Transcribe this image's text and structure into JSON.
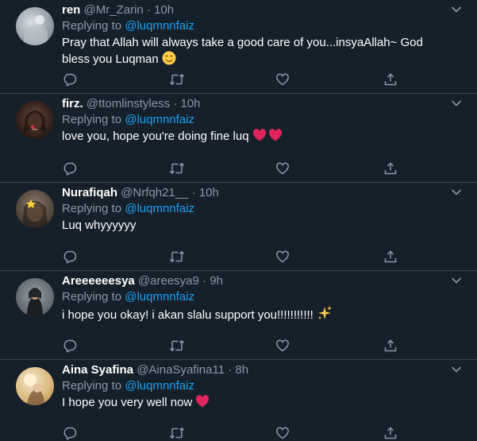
{
  "replying_label": "Replying to",
  "replying_mention": "@luqmnnfaiz",
  "tweets": [
    {
      "name": "ren",
      "handle": "@Mr_Zarin",
      "separator": "·",
      "time": "10h",
      "text": "Pray that Allah will always take a good care of you...insyaAllah~ God bless you Luqman",
      "emoji": "☺"
    },
    {
      "name": "firz.",
      "handle": "@ttomlinstyless",
      "separator": "·",
      "time": "10h",
      "text": "love you, hope you're doing fine luq",
      "emoji": "❤️❤️"
    },
    {
      "name": "Nurafiqah",
      "handle": "@Nrfqh21__",
      "separator": "·",
      "time": "10h",
      "text": "Luq whyyyyyy",
      "emoji": ""
    },
    {
      "name": "Areeeeeesya",
      "handle": "@areesya9",
      "separator": "·",
      "time": "9h",
      "text": "i hope you okay!  i akan slalu support you!!!!!!!!!!!",
      "emoji": "✨"
    },
    {
      "name": "Aina Syafina",
      "handle": "@AinaSyafina11",
      "separator": "·",
      "time": "8h",
      "text": "I hope you very well now",
      "emoji": "❤️"
    }
  ],
  "colors": {
    "background": "#15202b",
    "secondary_text": "#8899a6",
    "link": "#1da1f2",
    "divider": "#38444d",
    "heart_emoji": "#e0245e"
  },
  "icons": [
    "reply-icon",
    "retweet-icon",
    "like-icon",
    "share-icon",
    "chevron-down-icon"
  ]
}
